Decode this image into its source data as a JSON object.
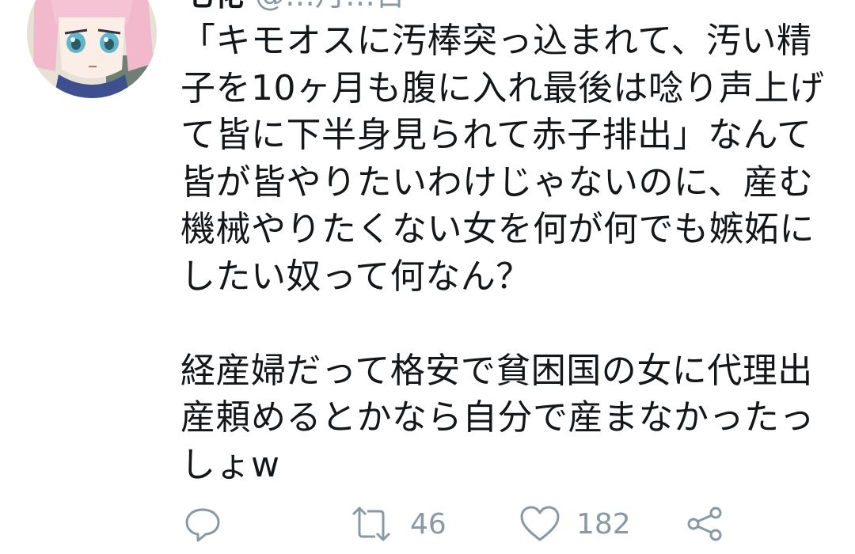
{
  "tweet": {
    "author_name": "七花",
    "author_handle": "@…月…日",
    "text": "「キモオスに汚棒突っ込まれて、汚い精子を10ヶ月も腹に入れ最後は唸り声上げて皆に下半身見られて赤子排出」なんて皆が皆やりたいわけじゃないのに、産む機械やりたくない女を何が何でも嫉妬にしたい奴って何なん？\n\n経産婦だって格安で貧困国の女に代理出産頼めるとかなら自分で産まなかったっしょw"
  },
  "actions": {
    "reply_icon": "reply-icon",
    "retweet_icon": "retweet-icon",
    "retweet_count": "46",
    "like_icon": "heart-icon",
    "like_count": "182",
    "share_icon": "share-icon"
  },
  "colors": {
    "text": "#14171a",
    "muted": "#8899a6",
    "background": "#ffffff"
  }
}
